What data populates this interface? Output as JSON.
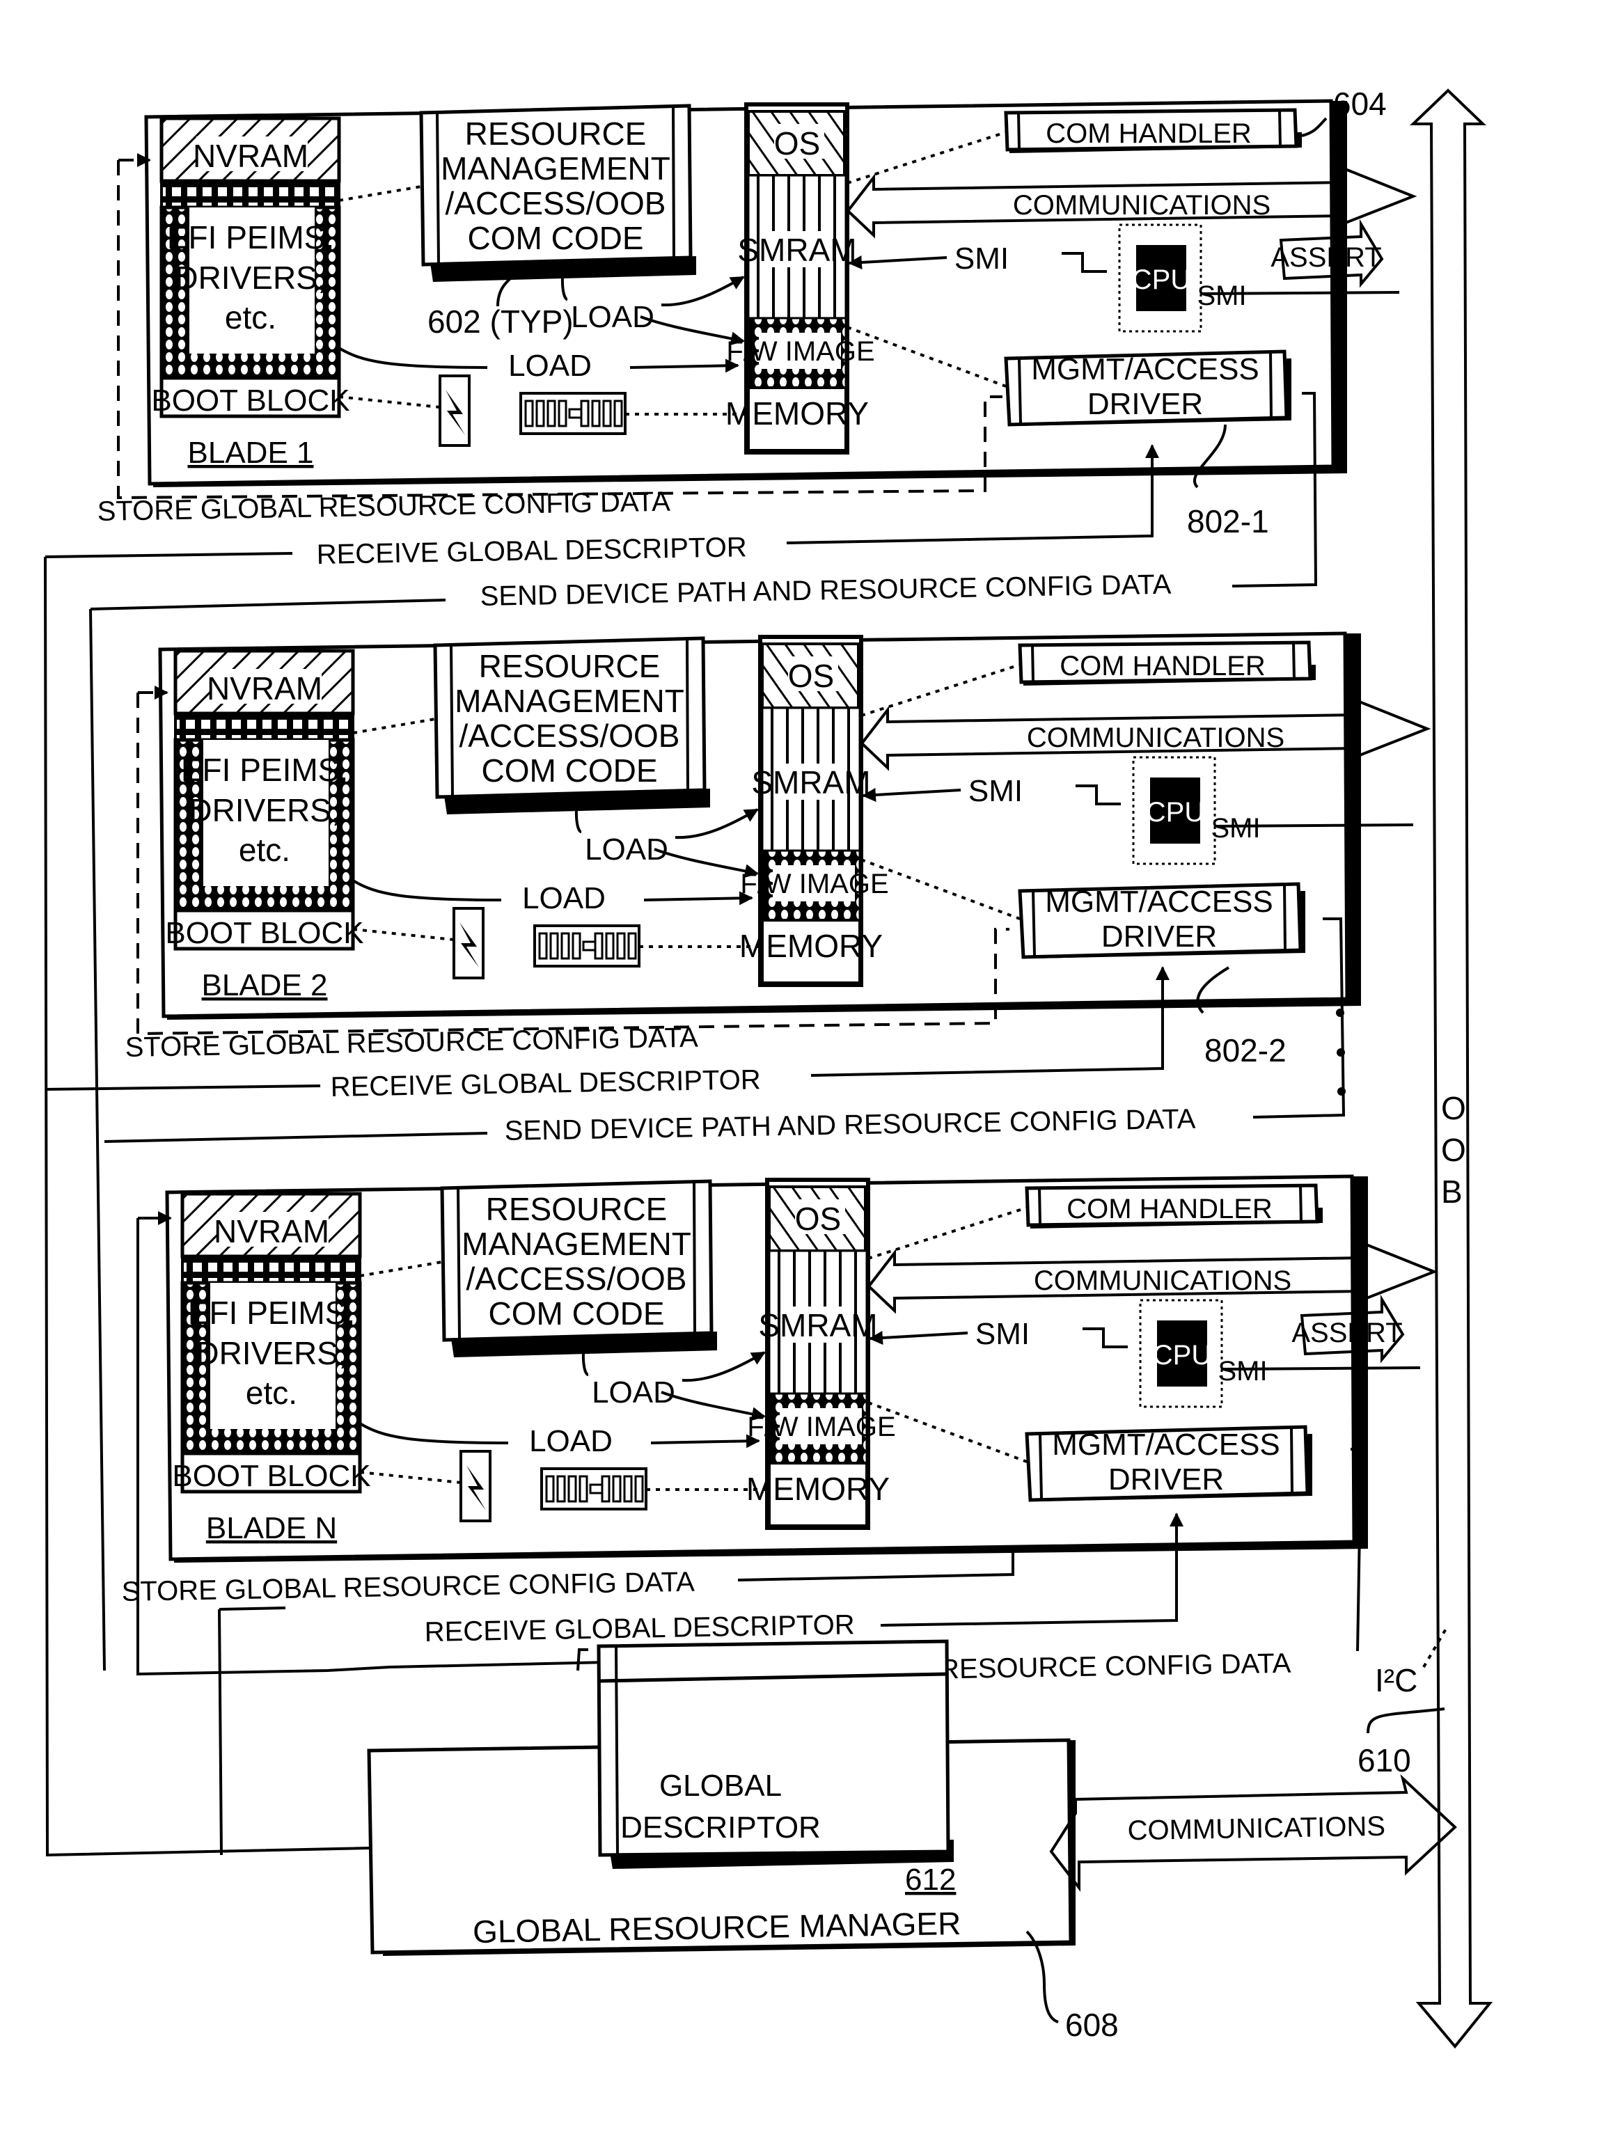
{
  "blades": [
    {
      "name": "BLADE 1",
      "nvram": "NVRAM",
      "efi": [
        "EFI PEIMS,",
        "DRIVERS,",
        "etc."
      ],
      "boot_block": "BOOT BLOCK",
      "resource_code": [
        "RESOURCE",
        "MANAGEMENT",
        "/ACCESS/OOB",
        "COM CODE"
      ],
      "os": "OS",
      "smram": "SMRAM",
      "fw_image": "F/W IMAGE",
      "memory": "MEMORY",
      "com_handler": "COM HANDLER",
      "communications": "COMMUNICATIONS",
      "smi": "SMI",
      "cpu": "CPU",
      "cpu_smi": "SMI",
      "assert": "ASSERT",
      "mgmt_driver": [
        "MGMT/ACCESS",
        "DRIVER"
      ],
      "load_labels": [
        "LOAD",
        "LOAD"
      ],
      "ref_typ": "602 (TYP)",
      "ref_driver": "802-1",
      "ref_blade": "604",
      "store_label": "STORE GLOBAL RESOURCE CONFIG DATA",
      "receive_label": "RECEIVE GLOBAL DESCRIPTOR",
      "send_label": "SEND DEVICE PATH AND RESOURCE CONFIG DATA"
    },
    {
      "name": "BLADE 2",
      "nvram": "NVRAM",
      "efi": [
        "EFI PEIMS,",
        "DRIVERS,",
        "etc."
      ],
      "boot_block": "BOOT BLOCK",
      "resource_code": [
        "RESOURCE",
        "MANAGEMENT",
        "/ACCESS/OOB",
        "COM CODE"
      ],
      "os": "OS",
      "smram": "SMRAM",
      "fw_image": "F/W IMAGE",
      "memory": "MEMORY",
      "com_handler": "COM HANDLER",
      "communications": "COMMUNICATIONS",
      "smi": "SMI",
      "cpu": "CPU",
      "cpu_smi": "SMI",
      "mgmt_driver": [
        "MGMT/ACCESS",
        "DRIVER"
      ],
      "load_labels": [
        "LOAD",
        "LOAD"
      ],
      "ref_driver": "802-2",
      "store_label": "STORE GLOBAL RESOURCE CONFIG DATA",
      "receive_label": "RECEIVE GLOBAL DESCRIPTOR",
      "send_label": "SEND DEVICE PATH AND RESOURCE CONFIG DATA"
    },
    {
      "name": "BLADE N",
      "nvram": "NVRAM",
      "efi": [
        "EFI PEIMS,",
        "DRIVERS,",
        "etc."
      ],
      "boot_block": "BOOT BLOCK",
      "resource_code": [
        "RESOURCE",
        "MANAGEMENT",
        "/ACCESS/OOB",
        "COM CODE"
      ],
      "os": "OS",
      "smram": "SMRAM",
      "fw_image": "F/W IMAGE",
      "memory": "MEMORY",
      "com_handler": "COM HANDLER",
      "communications": "COMMUNICATIONS",
      "smi": "SMI",
      "cpu": "CPU",
      "cpu_smi": "SMI",
      "assert": "ASSERT",
      "mgmt_driver": [
        "MGMT/ACCESS",
        "DRIVER"
      ],
      "load_labels": [
        "LOAD",
        "LOAD"
      ],
      "store_label": "STORE GLOBAL RESOURCE CONFIG DATA",
      "receive_label": "RECEIVE GLOBAL DESCRIPTOR",
      "send_label": "SEND DEVICE PATH AND RESOURCE CONFIG DATA"
    }
  ],
  "bus": {
    "oob_label": [
      "O",
      "O",
      "B"
    ],
    "i2c_label": "I²C",
    "ref": "610",
    "ellipsis": "⋮"
  },
  "manager": {
    "title": "GLOBAL RESOURCE MANAGER",
    "descriptor": [
      "GLOBAL",
      "DESCRIPTOR"
    ],
    "descriptor_ref": "612",
    "communications": "COMMUNICATIONS",
    "ref": "608"
  }
}
